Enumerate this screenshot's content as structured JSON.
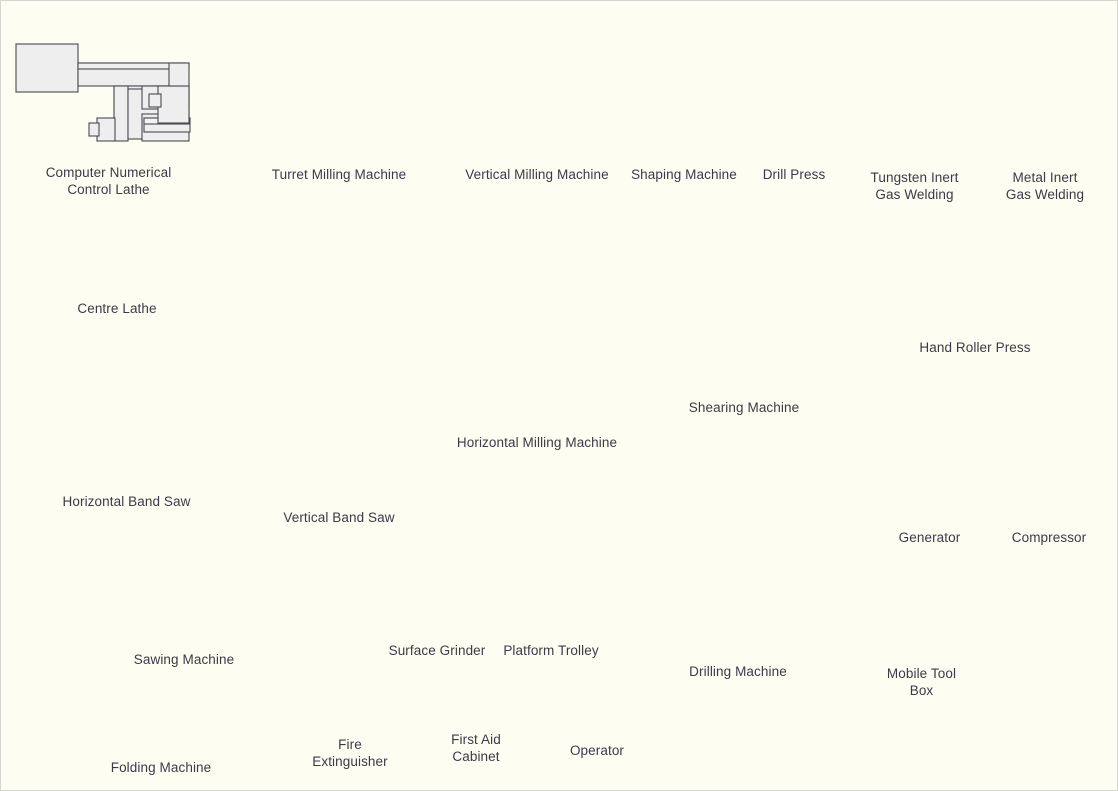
{
  "page": {
    "title": "Machine Shop Equipment Stencil",
    "background_color": "#fdfdf2",
    "border_color": "#d6d6d0",
    "line_color": "#4a4a52",
    "fill_color": "#eeeeee",
    "caption_color": "#3b3b47",
    "accent_red": "#ee1111"
  },
  "shapes": [
    {
      "id": "cnc-lathe",
      "label": "Computer Numerical\nControl Lathe",
      "icon": "cnc-lathe-icon"
    },
    {
      "id": "turret-milling-machine",
      "label": "Turret Milling Machine",
      "icon": "turret-milling-machine-icon"
    },
    {
      "id": "vertical-milling-machine",
      "label": "Vertical Milling Machine",
      "icon": "vertical-milling-machine-icon"
    },
    {
      "id": "shaping-machine",
      "label": "Shaping Machine",
      "icon": "shaping-machine-icon"
    },
    {
      "id": "drill-press",
      "label": "Drill Press",
      "icon": "drill-press-icon"
    },
    {
      "id": "tungsten-inert-gas-welding",
      "label": "Tungsten Inert\nGas Welding",
      "icon": "tig-welder-icon"
    },
    {
      "id": "metal-inert-gas-welding",
      "label": "Metal Inert\nGas Welding",
      "icon": "mig-welder-icon"
    },
    {
      "id": "centre-lathe",
      "label": "Centre Lathe",
      "icon": "centre-lathe-icon"
    },
    {
      "id": "horizontal-band-saw",
      "label": "Horizontal Band Saw",
      "icon": "horizontal-band-saw-icon"
    },
    {
      "id": "vertical-band-saw",
      "label": "Vertical Band Saw",
      "icon": "vertical-band-saw-icon"
    },
    {
      "id": "horizontal-milling-machine",
      "label": "Horizontal Milling Machine",
      "icon": "horizontal-milling-machine-icon"
    },
    {
      "id": "shearing-machine",
      "label": "Shearing Machine",
      "icon": "shearing-machine-icon"
    },
    {
      "id": "hand-roller-press",
      "label": "Hand Roller Press",
      "icon": "hand-roller-press-icon"
    },
    {
      "id": "generator",
      "label": "Generator",
      "icon": "generator-icon"
    },
    {
      "id": "compressor",
      "label": "Compressor",
      "icon": "compressor-icon"
    },
    {
      "id": "sawing-machine",
      "label": "Sawing Machine",
      "icon": "sawing-machine-icon"
    },
    {
      "id": "surface-grinder",
      "label": "Surface Grinder",
      "icon": "surface-grinder-icon"
    },
    {
      "id": "platform-trolley",
      "label": "Platform Trolley",
      "icon": "platform-trolley-icon"
    },
    {
      "id": "drilling-machine",
      "label": "Drilling Machine",
      "icon": "drilling-machine-icon"
    },
    {
      "id": "mobile-tool-box",
      "label": "Mobile Tool\nBox",
      "icon": "mobile-tool-box-icon"
    },
    {
      "id": "folding-machine",
      "label": "Folding Machine",
      "icon": "folding-machine-icon"
    },
    {
      "id": "fire-extinguisher",
      "label": "Fire\nExtinguisher",
      "icon": "fire-extinguisher-icon"
    },
    {
      "id": "first-aid-cabinet",
      "label": "First Aid\nCabinet",
      "icon": "first-aid-cabinet-icon"
    },
    {
      "id": "operator",
      "label": "Operator",
      "icon": "operator-icon"
    }
  ]
}
